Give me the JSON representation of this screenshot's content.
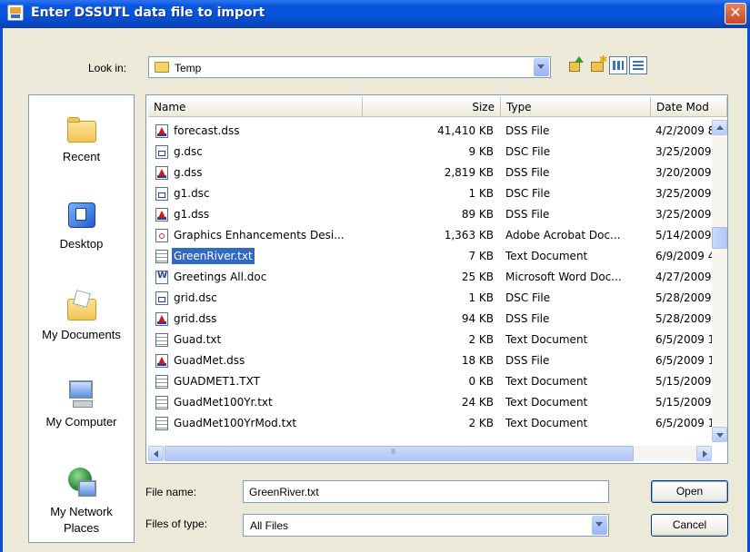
{
  "window": {
    "title": "Enter DSSUTL data file to import",
    "close_glyph": "✕"
  },
  "look_in": {
    "label": "Look in:",
    "value": "Temp"
  },
  "toolbar": {
    "icons": [
      "up-folder-icon",
      "new-folder-icon",
      "list-view-icon",
      "details-view-icon"
    ]
  },
  "places": [
    {
      "label": "Recent",
      "icon": "recent-folder-icon"
    },
    {
      "label": "Desktop",
      "icon": "desktop-icon"
    },
    {
      "label": "My Documents",
      "icon": "my-documents-icon"
    },
    {
      "label": "My Computer",
      "icon": "my-computer-icon"
    },
    {
      "label": "My Network Places",
      "icon": "network-places-icon"
    }
  ],
  "columns": [
    "Name",
    "Size",
    "Type",
    "Date Mod"
  ],
  "files": [
    {
      "name": "forecast.dss",
      "size": "41,410 KB",
      "type": "DSS File",
      "date": "4/2/2009 8",
      "kind": "dss"
    },
    {
      "name": "g.dsc",
      "size": "9 KB",
      "type": "DSC File",
      "date": "3/25/2009",
      "kind": "dsc"
    },
    {
      "name": "g.dss",
      "size": "2,819 KB",
      "type": "DSS File",
      "date": "3/20/2009",
      "kind": "dss"
    },
    {
      "name": "g1.dsc",
      "size": "1 KB",
      "type": "DSC File",
      "date": "3/25/2009",
      "kind": "dsc"
    },
    {
      "name": "g1.dss",
      "size": "89 KB",
      "type": "DSS File",
      "date": "3/25/2009",
      "kind": "dss"
    },
    {
      "name": "Graphics Enhancements Desi...",
      "size": "1,363 KB",
      "type": "Adobe Acrobat Doc...",
      "date": "5/14/2009",
      "kind": "pdf"
    },
    {
      "name": "GreenRiver.txt",
      "size": "7 KB",
      "type": "Text Document",
      "date": "6/9/2009 4",
      "kind": "txt",
      "selected": true
    },
    {
      "name": "Greetings All.doc",
      "size": "25 KB",
      "type": "Microsoft Word Doc...",
      "date": "4/27/2009",
      "kind": "doc"
    },
    {
      "name": "grid.dsc",
      "size": "1 KB",
      "type": "DSC File",
      "date": "5/28/2009",
      "kind": "dsc"
    },
    {
      "name": "grid.dss",
      "size": "94 KB",
      "type": "DSS File",
      "date": "5/28/2009",
      "kind": "dss"
    },
    {
      "name": "Guad.txt",
      "size": "2 KB",
      "type": "Text Document",
      "date": "6/5/2009 1",
      "kind": "txt"
    },
    {
      "name": "GuadMet.dss",
      "size": "18 KB",
      "type": "DSS File",
      "date": "6/5/2009 1",
      "kind": "dss"
    },
    {
      "name": "GUADMET1.TXT",
      "size": "0 KB",
      "type": "Text Document",
      "date": "5/15/2009",
      "kind": "txt"
    },
    {
      "name": "GuadMet100Yr.txt",
      "size": "24 KB",
      "type": "Text Document",
      "date": "5/15/2009",
      "kind": "txt"
    },
    {
      "name": "GuadMet100YrMod.txt",
      "size": "2 KB",
      "type": "Text Document",
      "date": "6/5/2009 1",
      "kind": "txt"
    }
  ],
  "file_name": {
    "label": "File name:",
    "value": "GreenRiver.txt"
  },
  "file_type": {
    "label": "Files of type:",
    "value": "All Files"
  },
  "buttons": {
    "open": "Open",
    "cancel": "Cancel"
  },
  "colors": {
    "titlebar": "#0a58e0",
    "selection": "#316ac5",
    "dialog_bg": "#ece9d8",
    "close": "#d8522e"
  }
}
